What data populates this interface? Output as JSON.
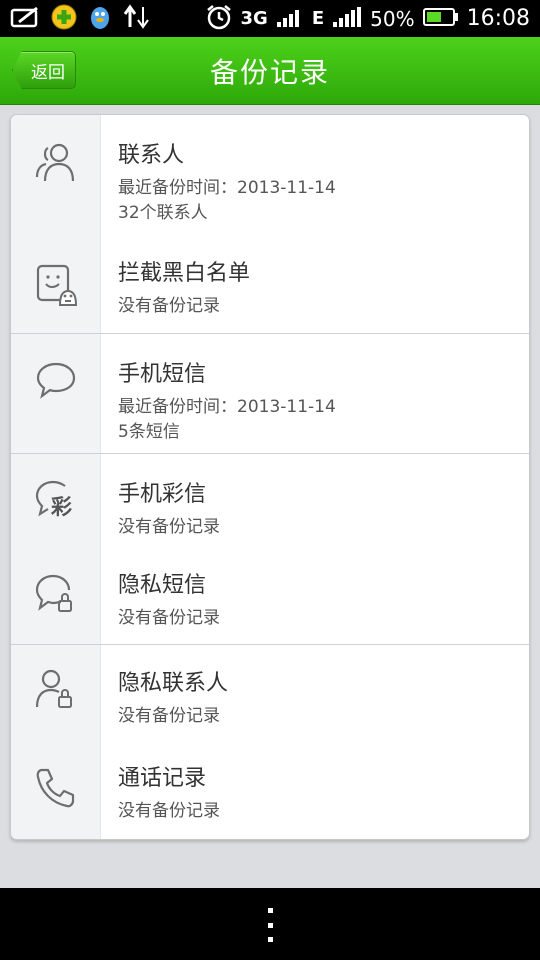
{
  "status_bar": {
    "net_3g": "3G",
    "net_e": "E",
    "battery": "50%",
    "time": "16:08"
  },
  "nav": {
    "back_label": "返回",
    "title": "备份记录"
  },
  "items": [
    {
      "title": "联系人",
      "sub1": "最近备份时间：2013-11-14",
      "sub2": "32个联系人",
      "icon": "contacts-icon"
    },
    {
      "title": "拦截黑白名单",
      "sub1": "没有备份记录",
      "icon": "blocklist-icon"
    },
    {
      "title": "手机短信",
      "sub1": "最近备份时间：2013-11-14",
      "sub2": "5条短信",
      "icon": "sms-icon"
    },
    {
      "title": "手机彩信",
      "sub1": "没有备份记录",
      "icon": "mms-icon",
      "icon_text": "彩"
    },
    {
      "title": "隐私短信",
      "sub1": "没有备份记录",
      "icon": "private-sms-icon"
    },
    {
      "title": "隐私联系人",
      "sub1": "没有备份记录",
      "icon": "private-contact-icon"
    },
    {
      "title": "通话记录",
      "sub1": "没有备份记录",
      "icon": "phone-icon"
    }
  ],
  "colors": {
    "nav_green": "#3cbd12",
    "icon_gray": "#6e6e6e"
  }
}
